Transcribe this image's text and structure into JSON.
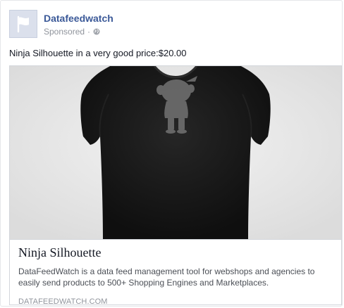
{
  "page": {
    "name": "Datafeedwatch",
    "sponsored": "Sponsored",
    "separator": "·",
    "privacy_icon": "globe-icon",
    "avatar_icon": "flag-icon"
  },
  "message": "Ninja Silhouette in a very good price:$20.00",
  "link": {
    "image_icon": "tshirt-image",
    "title": "Ninja Silhouette",
    "description": "DataFeedWatch is a data feed management tool for webshops and agencies to easily send products to 500+ Shopping Engines and Marketplaces.",
    "domain": "DATAFEEDWATCH.COM"
  },
  "colors": {
    "brand_link": "#3b5998",
    "muted": "#90949c",
    "shirt": "#181818"
  }
}
